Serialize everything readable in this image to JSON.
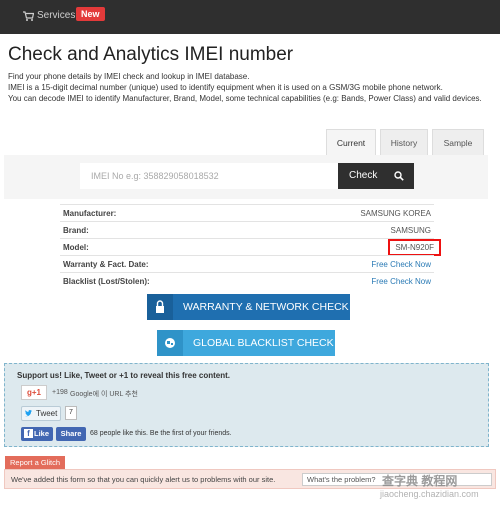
{
  "topbar": {
    "services_label": "Services",
    "new_badge": "New"
  },
  "page": {
    "title": "Check and Analytics IMEI number",
    "intro": [
      "Find your phone details by IMEI check and lookup in IMEI database.",
      "IMEI is a 15-digit decimal number (unique) used to identify equipment when it is used on a GSM/3G mobile phone network.",
      "You can decode IMEI to identify Manufacturer, Brand, Model, some technical capabilities (e.g: Bands, Power Class) and valid devices."
    ]
  },
  "tabs": [
    {
      "label": "Current",
      "active": true
    },
    {
      "label": "History",
      "active": false
    },
    {
      "label": "Sample",
      "active": false
    }
  ],
  "search": {
    "placeholder": "IMEI No e.g: 358829058018532",
    "value": "",
    "button_label": "Check"
  },
  "results": [
    {
      "key": "Manufacturer:",
      "value": "SAMSUNG KOREA",
      "link": false
    },
    {
      "key": "Brand:",
      "value": "SAMSUNG",
      "link": false
    },
    {
      "key": "Model:",
      "value": "SM-N920F",
      "link": false,
      "highlighted": true
    },
    {
      "key": "Warranty & Fact. Date:",
      "value": "Free Check Now",
      "link": true
    },
    {
      "key": "Blacklist (Lost/Stolen):",
      "value": "Free Check Now",
      "link": true
    }
  ],
  "actions": {
    "warranty_label": "WARRANTY & NETWORK CHECK",
    "blacklist_label": "GLOBAL BLACKLIST CHECK"
  },
  "support": {
    "title": "Support us! Like, Tweet or +1 to reveal this free content.",
    "gplus_label": "g+1",
    "gplus_count": "+198",
    "gplus_text": "Google에 이 URL 추천",
    "tweet_label": "Tweet",
    "tweet_count": "7",
    "fb_like_label": "Like",
    "fb_share_label": "Share",
    "fb_text": "68 people like this. Be the first of your friends."
  },
  "glitch": {
    "tab_label": "Report a Glitch",
    "text": "We've added this form so that you can quickly alert us to problems with our site.",
    "input_placeholder": "What's the problem?"
  },
  "watermark": {
    "line1": "查字典 教程网",
    "line2": "jiaocheng.chazidian.com"
  },
  "colors": {
    "topbar": "#2f2f2f",
    "new_badge": "#e33a3a",
    "warranty_button": "#1f6fb0",
    "blacklist_button": "#3ea8dd",
    "link": "#2a7ab5",
    "highlight_box": "#ee1111"
  }
}
